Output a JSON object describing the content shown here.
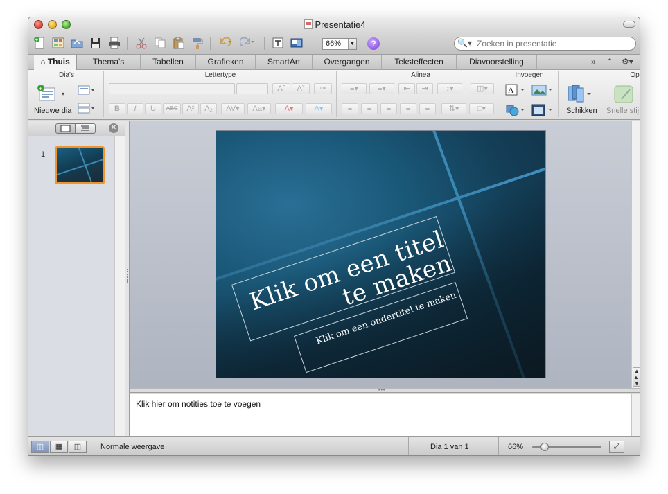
{
  "window": {
    "title": "Presentatie4"
  },
  "toolbar": {
    "zoom_value": "66%",
    "help_label": "?",
    "search_placeholder": "Zoeken in presentatie"
  },
  "ribbon_tabs": [
    {
      "label": "Thuis",
      "active": true
    },
    {
      "label": "Thema's"
    },
    {
      "label": "Tabellen"
    },
    {
      "label": "Grafieken"
    },
    {
      "label": "SmartArt"
    },
    {
      "label": "Overgangen"
    },
    {
      "label": "Teksteffecten"
    },
    {
      "label": "Diavoorstelling"
    }
  ],
  "ribbon_groups": {
    "slides": "Dia's",
    "font": "Lettertype",
    "paragraph": "Alinea",
    "insert": "Invoegen",
    "options": "Opm"
  },
  "ribbon_labels": {
    "new_slide": "Nieuwe dia",
    "arrange": "Schikken",
    "quick_styles": "Snelle stij"
  },
  "slide_panel": {
    "slide_number": "1"
  },
  "slide": {
    "title_placeholder_line1": "Klik om een titel",
    "title_placeholder_line2": "te maken",
    "subtitle_placeholder": "Klik om een ondertitel te maken"
  },
  "notes": {
    "placeholder": "Klik hier om notities toe te voegen"
  },
  "status": {
    "view_name": "Normale weergave",
    "slide_position": "Dia 1 van 1",
    "zoom": "66%"
  },
  "colors": {
    "accent_selection": "#f0942c",
    "slide_dark": "#0f2b3c",
    "slide_blue": "#1a5878"
  }
}
